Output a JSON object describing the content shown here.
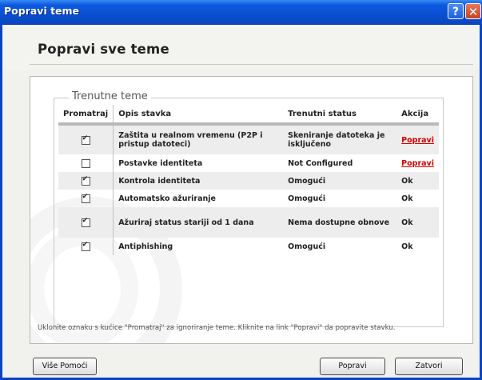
{
  "window": {
    "title": "Popravi teme"
  },
  "header": {
    "title": "Popravi sve teme"
  },
  "group": {
    "label": "Trenutne teme"
  },
  "table": {
    "columns": [
      "Promatraj",
      "Opis stavka",
      "Trenutni status",
      "Akcija"
    ],
    "rows": [
      {
        "checked": true,
        "description": "Zaštita u realnom vremenu (P2P i pristup datoteci)",
        "status": "Skeniranje datoteka je isključeno",
        "action": "Popravi",
        "action_link": true
      },
      {
        "checked": false,
        "description": "Postavke identiteta",
        "status": "Not Configured",
        "action": "Popravi",
        "action_link": true
      },
      {
        "checked": true,
        "description": "Kontrola identiteta",
        "status": "Omogući",
        "action": "Ok",
        "action_link": false
      },
      {
        "checked": true,
        "description": "Automatsko ažuriranje",
        "status": "Omogući",
        "action": "Ok",
        "action_link": false
      },
      {
        "checked": true,
        "description": "Ažuriraj status stariji od 1 dana",
        "status": "Nema dostupne obnove",
        "action": "Ok",
        "action_link": false
      },
      {
        "checked": true,
        "description": "Antiphishing",
        "status": "Omogući",
        "action": "Ok",
        "action_link": false
      }
    ]
  },
  "footer": {
    "hint": "Uklonite oznaku s kućice \"Promatraj\" za ignoriranje teme. Kliknite na link \"Popravi\" da popravite stavku."
  },
  "buttons": {
    "help": "Više Pomoći",
    "fix": "Popravi",
    "close": "Zatvori"
  },
  "titlebar_buttons": {
    "help": "?",
    "close": "✕"
  },
  "colors": {
    "link": "#d40000",
    "titlebar": "#0b52d8"
  }
}
